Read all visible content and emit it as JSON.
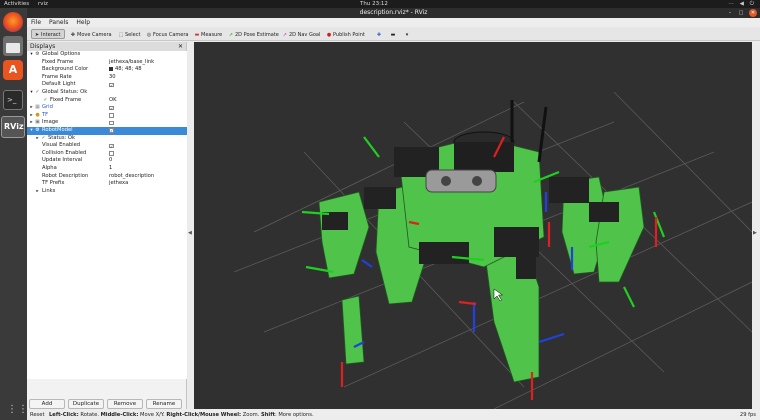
{
  "topbar": {
    "activities": "Activities",
    "app_name": "rviz",
    "clock": "Thu 23:12"
  },
  "window": {
    "title": "description.rviz* - RViz"
  },
  "menu": {
    "file": "File",
    "panels": "Panels",
    "help": "Help"
  },
  "toolbar": {
    "interact": "Interact",
    "move_camera": "Move Camera",
    "select": "Select",
    "focus_camera": "Focus Camera",
    "measure": "Measure",
    "pose_estimate": "2D Pose Estimate",
    "nav_goal": "2D Nav Goal",
    "publish_point": "Publish Point"
  },
  "displays": {
    "title": "Displays",
    "global_options": "Global Options",
    "fixed_frame_label": "Fixed Frame",
    "fixed_frame_value": "jethexa/base_link",
    "background_label": "Background Color",
    "background_value": "48; 48; 48",
    "frame_rate_label": "Frame Rate",
    "frame_rate_value": "30",
    "default_light_label": "Default Light",
    "global_status": "Global Status: Ok",
    "status_fixed_frame": "Fixed Frame",
    "status_fixed_frame_value": "OK",
    "grid": "Grid",
    "tf": "TF",
    "image": "Image",
    "robot_model": "RobotModel",
    "rm_status": "Status: Ok",
    "visual_enabled": "Visual Enabled",
    "collision_enabled": "Collision Enabled",
    "update_interval": "Update Interval",
    "update_interval_value": "0",
    "alpha": "Alpha",
    "alpha_value": "1",
    "robot_description": "Robot Description",
    "robot_description_value": "robot_description",
    "tf_prefix": "TF Prefix",
    "tf_prefix_value": "jethexa",
    "links": "Links"
  },
  "buttons": {
    "add": "Add",
    "duplicate": "Duplicate",
    "remove": "Remove",
    "rename": "Rename"
  },
  "status": {
    "reset": "Reset",
    "left_click": "Left-Click:",
    "left_click_action": " Rotate. ",
    "middle_click": "Middle-Click:",
    "middle_click_action": " Move X/Y. ",
    "right_click": "Right-Click/Mouse Wheel:",
    "right_click_action": " Zoom. ",
    "shift": "Shift",
    "shift_action": ": More options.",
    "fps": "29 fps"
  },
  "colors": {
    "viewport_bg": "#303030",
    "robot_green": "#4fc34a",
    "robot_dark": "#222222",
    "axis_red": "#e02020",
    "axis_green": "#20d020",
    "axis_blue": "#2040e0",
    "selection": "#3a8ad8"
  },
  "icons": [
    "firefox-icon",
    "files-icon",
    "software-icon",
    "terminal-icon",
    "rviz-icon",
    "apps-grid-icon"
  ]
}
